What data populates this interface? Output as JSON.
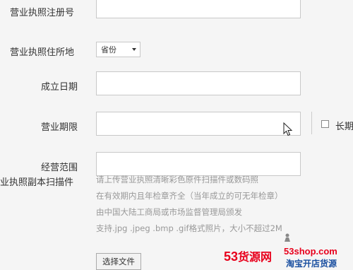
{
  "form": {
    "fields": {
      "license_number": {
        "label": "营业执照注册号",
        "value": ""
      },
      "license_address": {
        "label": "营业执照住所地",
        "select_value": "省份"
      },
      "established_date": {
        "label": "成立日期",
        "value": ""
      },
      "business_term": {
        "label": "营业期限",
        "value": "",
        "checkbox_label": "长期"
      },
      "business_scope": {
        "label": "经营范围",
        "value": ""
      },
      "license_copy": {
        "label": "业执照副本扫描件",
        "help_lines": [
          "请上传营业执照清晰彩色原件扫描件或数码照",
          "在有效期内且年检章齐全（当年成立的可无年检章）",
          "由中国大陆工商局或市场监督管理局颁发",
          "支持.jpg .jpeg .bmp .gif格式照片，大小不超过2M"
        ],
        "button_label": "选择文件"
      }
    }
  },
  "watermark": {
    "number": "53",
    "brand": "货源网",
    "url": "53shop.com",
    "slogan": "淘宝开店货源"
  },
  "colors": {
    "page_bg": "#f5f5f5",
    "watermark_red": "#e8001c",
    "watermark_blue": "#1a4fa0"
  }
}
